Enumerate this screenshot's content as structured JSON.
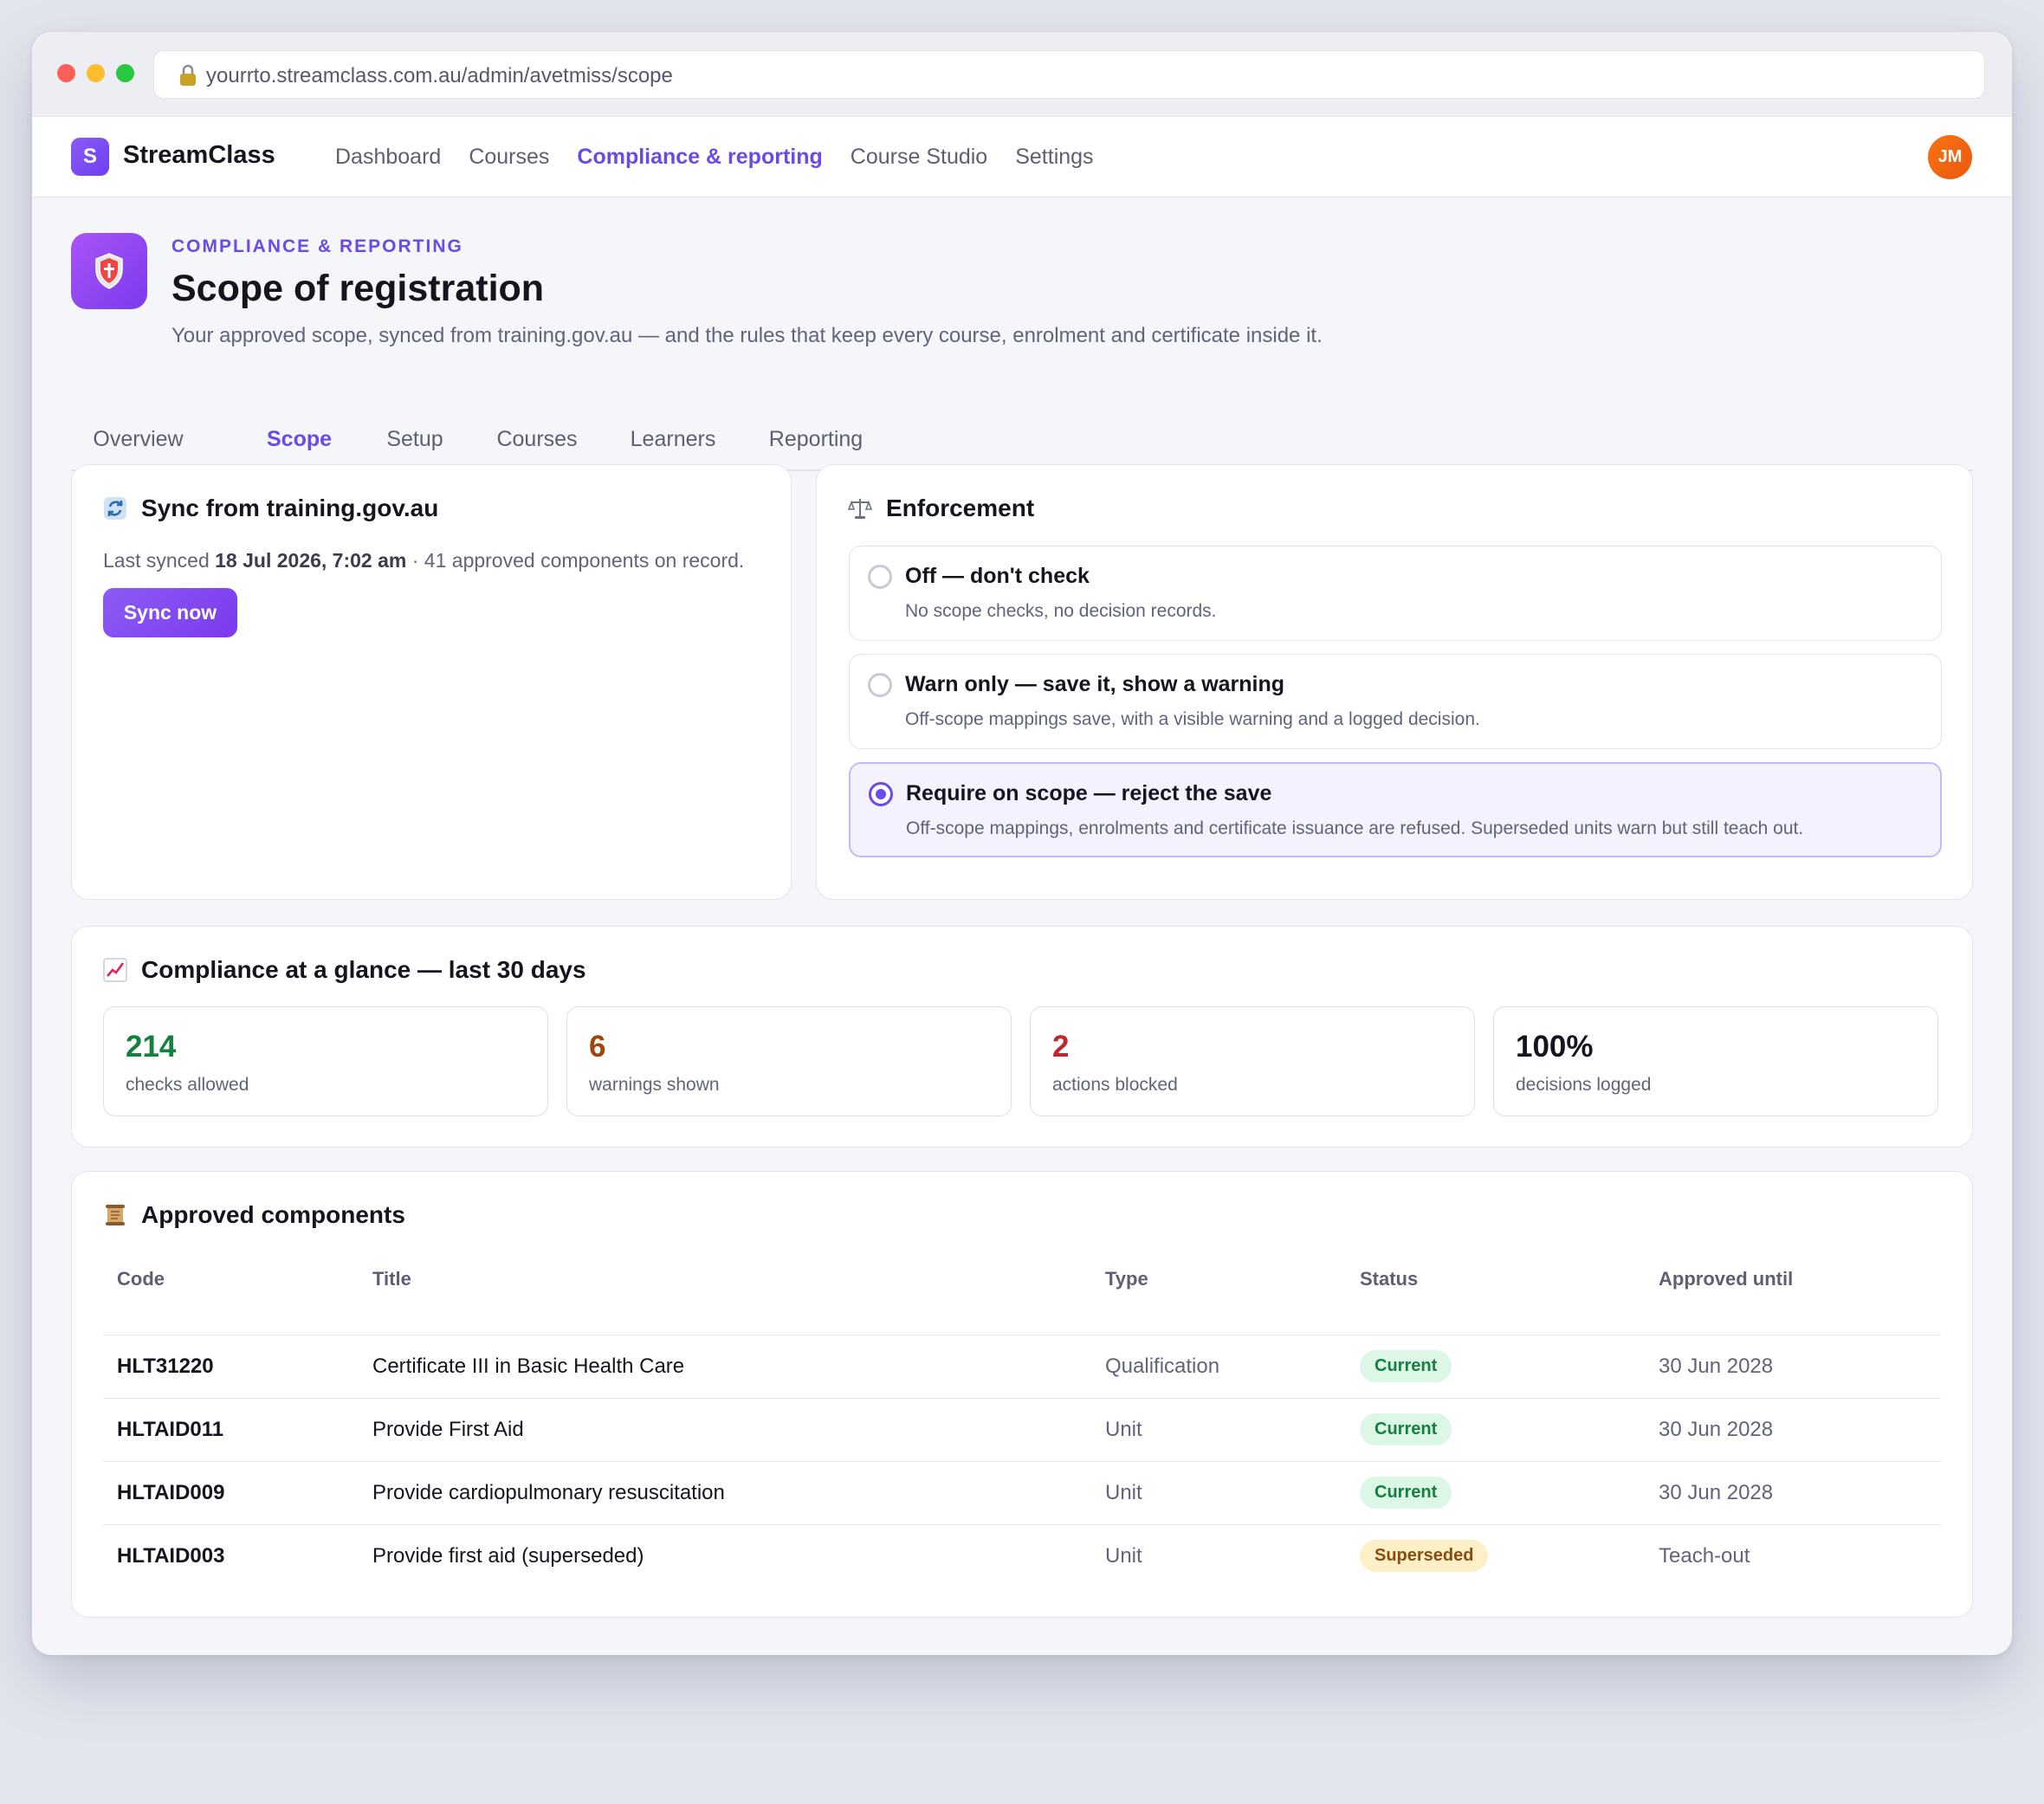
{
  "browser": {
    "url": "yourrto.streamclass.com.au/admin/avetmiss/scope"
  },
  "app": {
    "logo_letter": "S",
    "brand": "StreamClass",
    "nav": [
      {
        "label": "Dashboard",
        "active": false
      },
      {
        "label": "Courses",
        "active": false
      },
      {
        "label": "Compliance & reporting",
        "active": true
      },
      {
        "label": "Course Studio",
        "active": false
      },
      {
        "label": "Settings",
        "active": false
      }
    ],
    "avatar_initials": "JM"
  },
  "page": {
    "eyebrow": "COMPLIANCE & REPORTING",
    "title": "Scope of registration",
    "description": "Your approved scope, synced from training.gov.au — and the rules that keep every course, enrolment and certificate inside it."
  },
  "tabs": [
    {
      "label": "Overview",
      "active": false
    },
    {
      "label": "Scope",
      "active": true
    },
    {
      "label": "Setup",
      "active": false
    },
    {
      "label": "Courses",
      "active": false
    },
    {
      "label": "Learners",
      "active": false
    },
    {
      "label": "Reporting",
      "active": false
    }
  ],
  "sync": {
    "title": "Sync from training.gov.au",
    "meta_prefix": "Last synced ",
    "last_synced": "18 Jul 2026, 7:02 am",
    "meta_suffix": " · 41 approved components on record.",
    "button": "Sync now"
  },
  "enforcement": {
    "title": "Enforcement",
    "options": [
      {
        "title": "Off — don't check",
        "description": "No scope checks, no decision records.",
        "selected": false
      },
      {
        "title": "Warn only — save it, show a warning",
        "description": "Off-scope mappings save, with a visible warning and a logged decision.",
        "selected": false
      },
      {
        "title": "Require on scope — reject the save",
        "description": "Off-scope mappings, enrolments and certificate issuance are refused. Superseded units warn but still teach out.",
        "selected": true
      }
    ]
  },
  "glance": {
    "title": "Compliance at a glance — last 30 days",
    "stats": [
      {
        "value": "214",
        "label": "checks allowed",
        "color": "#15803d"
      },
      {
        "value": "6",
        "label": "warnings shown",
        "color": "#a0450b"
      },
      {
        "value": "2",
        "label": "actions blocked",
        "color": "#c0262d"
      },
      {
        "value": "100%",
        "label": "decisions logged",
        "color": "#15151f"
      }
    ]
  },
  "components": {
    "title": "Approved components",
    "columns": [
      "Code",
      "Title",
      "Type",
      "Status",
      "Approved until"
    ],
    "rows": [
      {
        "code": "HLT31220",
        "title": "Certificate III in Basic Health Care",
        "type": "Qualification",
        "status": "Current",
        "until": "30 Jun 2028"
      },
      {
        "code": "HLTAID011",
        "title": "Provide First Aid",
        "type": "Unit",
        "status": "Current",
        "until": "30 Jun 2028"
      },
      {
        "code": "HLTAID009",
        "title": "Provide cardiopulmonary resuscitation",
        "type": "Unit",
        "status": "Current",
        "until": "30 Jun 2028"
      },
      {
        "code": "HLTAID003",
        "title": "Provide first aid (superseded)",
        "type": "Unit",
        "status": "Superseded",
        "until": "Teach-out"
      }
    ]
  },
  "colors": {
    "accent": "#6a4ae8",
    "current_badge": "#dcf7e6",
    "superseded_badge": "#fdf0c9"
  }
}
